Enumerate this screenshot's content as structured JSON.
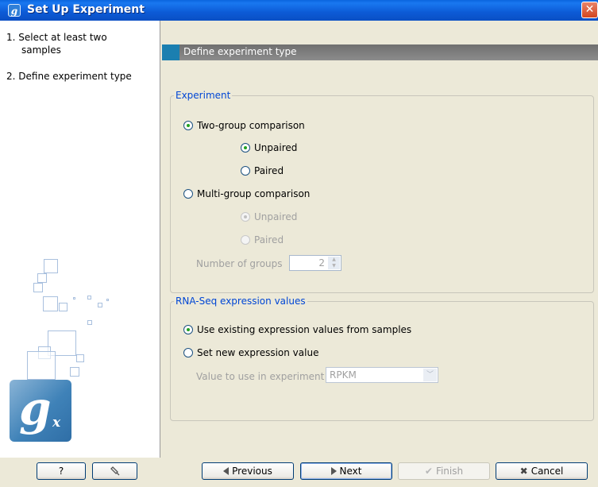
{
  "window": {
    "title": "Set Up Experiment",
    "icon": "gx-app-icon",
    "close_label": "✕"
  },
  "steps": [
    {
      "number": "1.",
      "lines": [
        "Select at least two",
        "samples"
      ]
    },
    {
      "number": "2.",
      "lines": [
        "Define experiment type"
      ]
    }
  ],
  "header": {
    "title": "Define experiment type"
  },
  "experiment": {
    "legend": "Experiment",
    "two_group": {
      "label": "Two-group comparison",
      "checked": true
    },
    "two_group_unpaired": {
      "label": "Unpaired",
      "checked": true
    },
    "two_group_paired": {
      "label": "Paired",
      "checked": false
    },
    "multi_group": {
      "label": "Multi-group comparison",
      "checked": false
    },
    "multi_group_unpaired": {
      "label": "Unpaired",
      "checked": true,
      "disabled": true
    },
    "multi_group_paired": {
      "label": "Paired",
      "checked": false,
      "disabled": true
    },
    "groups_label": "Number of groups",
    "groups_value": "2"
  },
  "rnaseq": {
    "legend": "RNA-Seq expression values",
    "use_existing": {
      "label": "Use existing expression values from samples",
      "checked": true
    },
    "set_new": {
      "label": "Set new expression value",
      "checked": false
    },
    "value_label": "Value to use in experiment",
    "value_selected": "RPKM"
  },
  "footer": {
    "help_label": "?",
    "reset_icon": "reset-icon",
    "previous_label": "Previous",
    "next_label": "Next",
    "finish_label": "Finish",
    "cancel_label": "Cancel"
  },
  "colors": {
    "accent": "#0046d5",
    "title_bar": "#0a5ad6",
    "header_mark": "#1b7fb0",
    "radio_dot": "#21a121"
  }
}
